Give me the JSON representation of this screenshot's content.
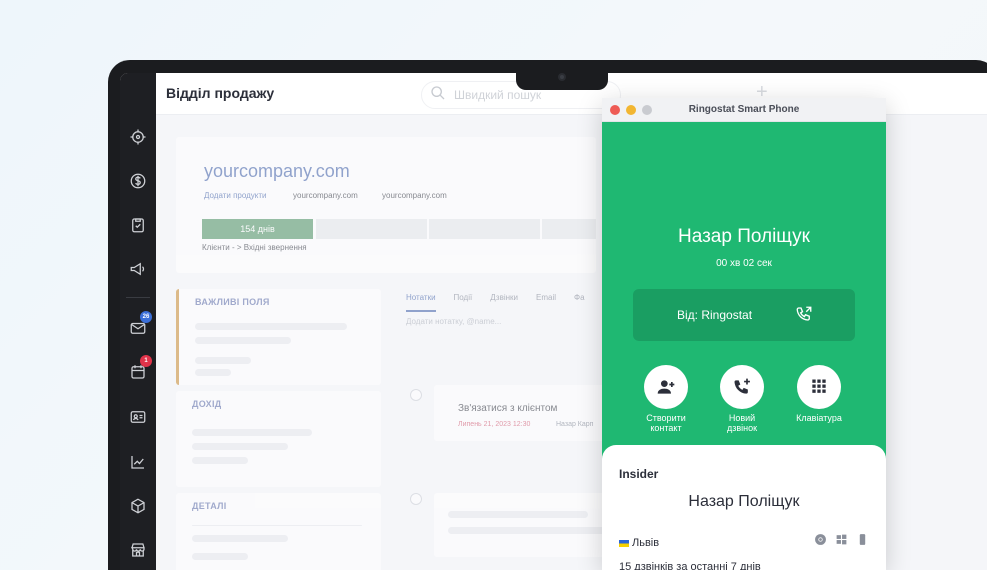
{
  "crm": {
    "page_title": "Відділ продажу",
    "search_placeholder": "Швидкий пошук",
    "add_symbol": "+",
    "company": {
      "name": "yourcompany.com",
      "add_products": "Додати продукти",
      "link_1": "yourcompany.com",
      "link_2": "yourcompany.com",
      "stage_days": "154 днів",
      "breadcrumb": "Клієнти - > Вхідні звернення"
    },
    "sections": {
      "important": "ВАЖЛИВІ ПОЛЯ",
      "income": "ДОХІД",
      "details": "ДЕТАЛІ"
    },
    "tabs": [
      "Нотатки",
      "Події",
      "Дзвінки",
      "Email",
      "Фа"
    ],
    "note_placeholder": "Додати нотатку, @name...",
    "task": {
      "title": "Зв'язатися з клієнтом",
      "date": "Липень 21, 2023 12:30",
      "owner": "Назар Карп"
    },
    "badges": {
      "mail": "26",
      "calendar": "1"
    }
  },
  "phone": {
    "window_title": "Ringostat Smart Phone",
    "caller_name": "Назар Поліщук",
    "call_duration": "00 хв 02 сек",
    "from_label": "Від: Ringostat",
    "actions": {
      "create_contact": [
        "Створити",
        "контакт"
      ],
      "new_call": [
        "Новий",
        "дзвінок"
      ],
      "keypad": [
        "Клавіатура"
      ]
    },
    "info": {
      "tag": "Insider",
      "name": "Назар Поліщук",
      "city": "Львів",
      "calls_summary": "15 дзвінків за останні 7 днів"
    }
  },
  "colors": {
    "phone_green": "#1fb872",
    "phone_green_dark": "#1a9e62",
    "brand_blue": "#3f5fa8",
    "stage_green": "#4a8f5f",
    "badge_blue": "#3b6fd8",
    "badge_red": "#e0334a"
  }
}
